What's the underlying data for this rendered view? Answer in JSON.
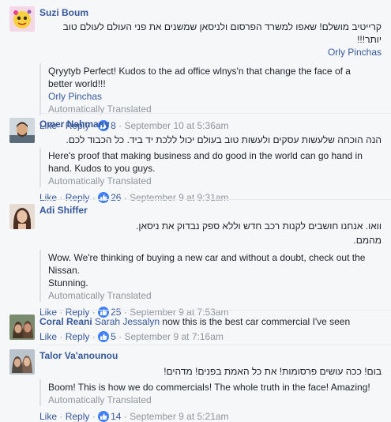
{
  "labels": {
    "like": "Like",
    "reply": "Reply",
    "dot": "·",
    "auto_translated": "Automatically Translated"
  },
  "comments": [
    {
      "author": "Suzi Boum",
      "hebrew": [
        "קרייטיב מושלם! שאפו למשרד הפרסום ולניסאן שמשנים את פני העולם לעולם טוב יותר!!!"
      ],
      "hebrew_mention": "Orly Pinchas",
      "translation": [
        "Qryytyb Perfect! Kudos to the ad office wlnys'n that change the face of a",
        "better world!!!"
      ],
      "translation_mention": "Orly Pinchas",
      "likes": "8",
      "time": "September 10 at 5:36am"
    },
    {
      "author": "Omer Nahmany",
      "hebrew": [
        "הנה הוכחה שלעשות עסקים ולעשות טוב בעולם יכול ללכת יד ביד. כל הכבוד לכם."
      ],
      "translation": [
        "Here's proof that making business and do good in the world can go hand in",
        "hand. Kudos to you guys."
      ],
      "likes": "26",
      "time": "September 9 at 9:31am"
    },
    {
      "author": "Adi Shiffer",
      "hebrew": [
        "וואו. אנחנו חושבים לקנות רכב חדש וללא ספק נבדוק את ניסאן.",
        "מהמם."
      ],
      "translation": [
        "Wow. We're thinking of buying a new car and without a doubt, check out the",
        "Nissan.",
        "Stunning."
      ],
      "likes": "25",
      "time": "September 9 at 7:53am"
    },
    {
      "author": "Coral Reani",
      "mention": "Sarah Jessalyn",
      "text": "now this is the best car commercial I've seen",
      "likes": "5",
      "time": "September 9 at 7:16am"
    },
    {
      "author": "Talor Va'anounou",
      "hebrew": [
        "בום! ככה עושים פרסומות! את כל האמת בפנים! מדהים!"
      ],
      "translation": [
        "Boom! This is how we do commercials! The whole truth in the face! Amazing!"
      ],
      "likes": "14",
      "time": "September 9 at 5:21am"
    }
  ],
  "colors": {
    "link": "#365899",
    "meta": "#90949c",
    "like_badge": "#4080ff",
    "background": "#f6f7f9"
  },
  "icons": [
    "avatar-suzi",
    "avatar-omer",
    "avatar-adi",
    "avatar-coral",
    "avatar-talor",
    "thumbs-up-icon"
  ]
}
